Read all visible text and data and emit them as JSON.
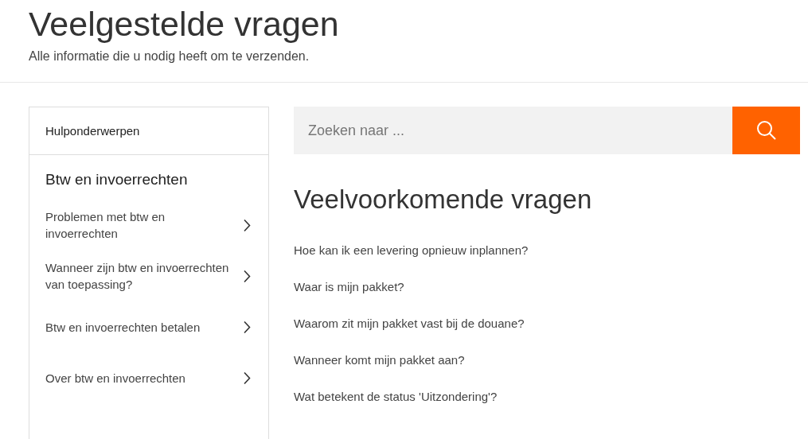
{
  "header": {
    "title": "Veelgestelde vragen",
    "subtitle": "Alle informatie die u nodig heeft om te verzenden."
  },
  "sidebar": {
    "heading": "Hulponderwerpen",
    "section_title": "Btw en invoerrechten",
    "items": [
      {
        "label": "Problemen met btw en invoerrechten"
      },
      {
        "label": "Wanneer zijn btw en invoerrechten van toepassing?"
      },
      {
        "label": "Btw en invoerrechten betalen"
      },
      {
        "label": "Over btw en invoerrechten"
      }
    ]
  },
  "search": {
    "placeholder": "Zoeken naar ..."
  },
  "faq": {
    "title": "Veelvoorkomende vragen",
    "questions": [
      "Hoe kan ik een levering opnieuw inplannen?",
      "Waar is mijn pakket?",
      "Waarom zit mijn pakket vast bij de douane?",
      "Wanneer komt mijn pakket aan?",
      "Wat betekent de status 'Uitzondering'?"
    ]
  }
}
